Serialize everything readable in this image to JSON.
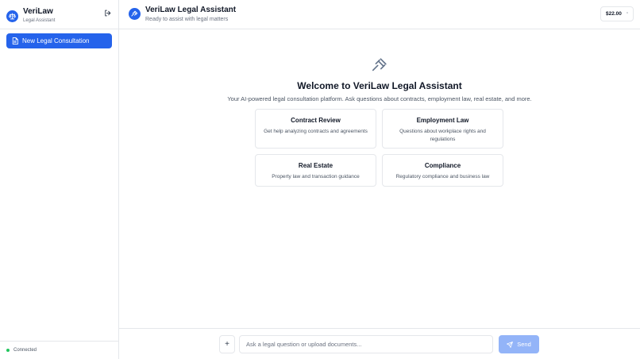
{
  "brand": {
    "name": "VeriLaw",
    "subtitle": "Legal Assistant"
  },
  "sidebar": {
    "new_consultation_label": "New Legal Consultation"
  },
  "status": {
    "text": "Connected",
    "color": "#22c55e"
  },
  "header": {
    "title": "VeriLaw Legal Assistant",
    "subtitle": "Ready to assist with legal matters",
    "credit": "$22.00"
  },
  "welcome": {
    "title": "Welcome to VeriLaw Legal Assistant",
    "description": "Your AI-powered legal consultation platform. Ask questions about contracts, employment law, real estate, and more."
  },
  "cards": [
    {
      "title": "Contract Review",
      "description": "Get help analyzing contracts and agreements"
    },
    {
      "title": "Employment Law",
      "description": "Questions about workplace rights and regulations"
    },
    {
      "title": "Real Estate",
      "description": "Property law and transaction guidance"
    },
    {
      "title": "Compliance",
      "description": "Regulatory compliance and business law"
    }
  ],
  "composer": {
    "attach_label": "+",
    "placeholder": "Ask a legal question or upload documents...",
    "value": "",
    "send_label": "Send"
  },
  "icons": {
    "brand": "scale-icon",
    "logout": "logout-icon",
    "new_consultation": "document-icon",
    "header": "gavel-icon",
    "welcome": "gavel-icon",
    "send": "send-icon"
  },
  "colors": {
    "accent": "#2563eb",
    "send_disabled": "#93b4f8"
  }
}
